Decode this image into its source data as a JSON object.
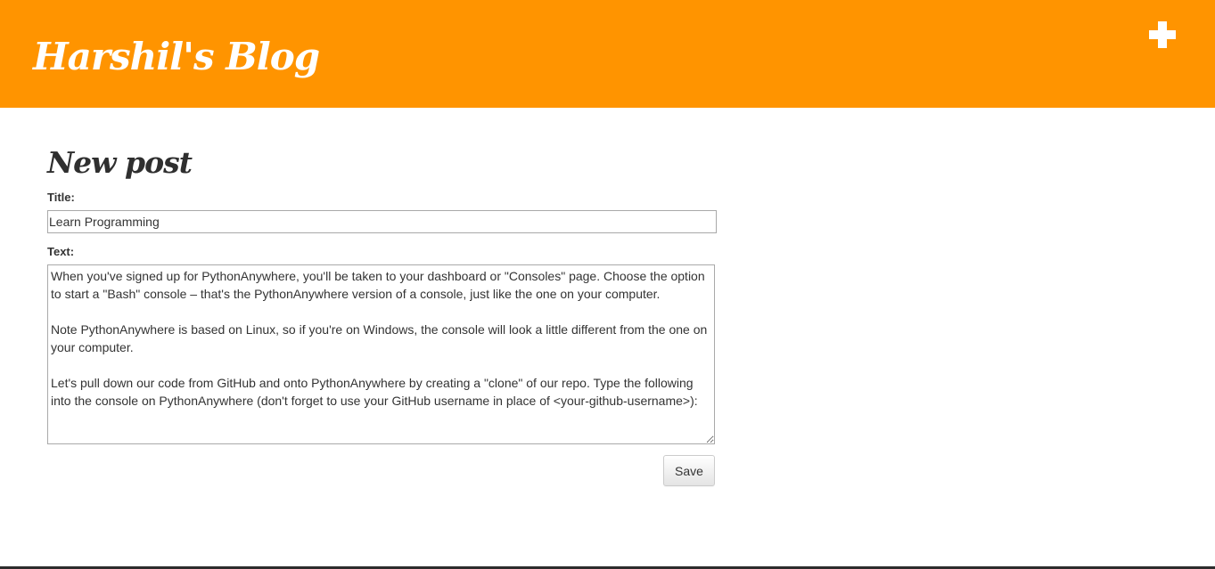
{
  "header": {
    "site_title": "Harshil's Blog",
    "add_post_icon": "plus-icon",
    "background_color": "#ff9400"
  },
  "form": {
    "heading": "New post",
    "title_label": "Title:",
    "title_value": "Learn Programming",
    "text_label": "Text:",
    "text_value": "When you've signed up for PythonAnywhere, you'll be taken to your dashboard or \"Consoles\" page. Choose the option to start a \"Bash\" console – that's the PythonAnywhere version of a console, just like the one on your computer.\n\nNote PythonAnywhere is based on Linux, so if you're on Windows, the console will look a little different from the one on your computer.\n\nLet's pull down our code from GitHub and onto PythonAnywhere by creating a \"clone\" of our repo. Type the following into the console on PythonAnywhere (don't forget to use your GitHub username in place of <your-github-username>):",
    "save_label": "Save"
  }
}
